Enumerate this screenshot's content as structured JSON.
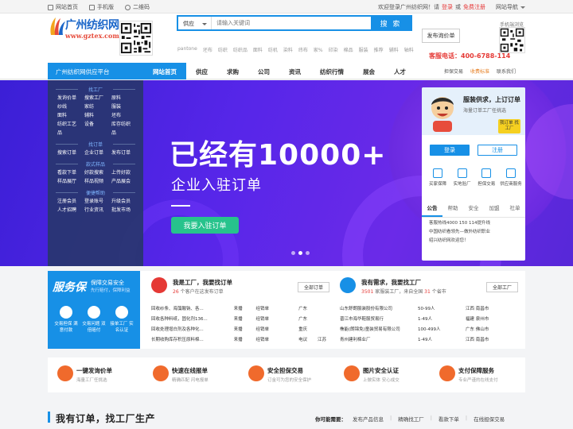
{
  "topbar": {
    "home": "网站首页",
    "mobile": "手机版",
    "qrcode": "二维码",
    "welcome": "欢迎登录广州纺织网！请",
    "login": "登录",
    "or": "或",
    "register": "免费注册",
    "sitenav": "网站导航"
  },
  "header": {
    "logo_cn": "广州纺织网",
    "logo_url": "www.gztex.com",
    "search_category": "供应",
    "search_placeholder": "请输入关键词",
    "search_button": "搜 索",
    "inquiry_button": "发布询价单",
    "hotline": "客服电话：400-6788-114",
    "mobile_label": "手机端浏览",
    "hotwords": [
      "pantone",
      "坯布",
      "纺织",
      "纺织品",
      "面料",
      "纺机",
      "染料",
      "纬布",
      "家%",
      "印染",
      "棉品",
      "服装",
      "推荐",
      "辅料",
      "轴料"
    ]
  },
  "nav": {
    "category_head": "广州纺织网供应平台",
    "items": [
      "网站首页",
      "供应",
      "求购",
      "公司",
      "资讯",
      "纺织行情",
      "展会",
      "人才"
    ],
    "right": [
      "担保交易",
      "收费标准",
      "联系我们"
    ]
  },
  "sidecat": {
    "sec1": "找工厂",
    "grid1": [
      "发询价单",
      "搜索工厂",
      "原料",
      "纱线",
      "家纺",
      "服装",
      "面料",
      "辅料",
      "坯布",
      "纺织工艺",
      "设备",
      "库存纺织",
      "品",
      "",
      "品"
    ],
    "sec2": "找订单",
    "grid2": [
      "搜索订单",
      "企业订单",
      "发布订单"
    ],
    "sec3": "款式样品",
    "grid3": [
      "看款下单",
      "好款搜索",
      "上传好款",
      "样品展厅",
      "样品视频",
      "产品展会"
    ],
    "sec4": "便捷帮助",
    "grid4": [
      "注册会员",
      "登录账号",
      "升级会员",
      "人才招聘",
      "行业资讯",
      "批发市场"
    ]
  },
  "banner": {
    "headline": "已经有10000+",
    "subline": "企业入驻订单",
    "cta": "我要入驻订单"
  },
  "panel": {
    "title": "服装供求，上订订单",
    "subtitle": "海量订单工厂任挑选",
    "tag": "我订单 找工厂",
    "login": "登录",
    "register": "注册",
    "services": [
      "买家保障",
      "实地验厂",
      "担保交易",
      "供应商服务"
    ],
    "tabs": [
      "公告",
      "帮助",
      "安全",
      "加盟",
      "社单"
    ],
    "news": [
      "客服热线4000 150 114提升线",
      "中国纺织看领先—做外纺织职业",
      "绍兴纺织网欢迎您！"
    ]
  },
  "guard": {
    "big": "服务保",
    "s1": "保障交易安全",
    "s2": "先行赔付，保障利益",
    "items": [
      "交易担保 满意付款",
      "交易问题 双倍赔付",
      "接单工厂 实名认证"
    ]
  },
  "factory": {
    "title": "我是工厂，我要找订单",
    "count_pre": "",
    "count": "26",
    "count_post": "个客户在这发布订单",
    "all": "全部订单",
    "rows": [
      [
        "回收纱条、海藻酸钠、各...",
        "来播",
        "经销单",
        "广东"
      ],
      [
        "回收各种料纸，固化剂136...",
        "来播",
        "经销单",
        "广东"
      ],
      [
        "回收处理增白剂及各种化...",
        "来播",
        "经销单",
        "重庆"
      ],
      [
        "长期收购库存积压原料棉...",
        "来播",
        "经销单",
        "电议",
        "江苏"
      ]
    ]
  },
  "buyer": {
    "title": "我有需求，我要找工厂",
    "count": "3501",
    "count_mid": "家服装工厂，来自全国",
    "provinces": "31",
    "count_post": "个省市",
    "all": "全部工厂",
    "rows": [
      [
        "山东舒朗服装股份有限公司",
        "50-99人",
        "江西 南昌市"
      ],
      [
        "晋江市海华鞋服贸易行",
        "1-49人",
        "福建 泉州市"
      ],
      [
        "樵能(朗锦免)童装贸易有限公司",
        "100-499人",
        "广东 佛山市"
      ],
      [
        "青州建利棉业厂",
        "1-49人",
        "江西 南昌市"
      ]
    ]
  },
  "features": [
    {
      "t": "一键发询价单",
      "s": "海量工厂任挑选"
    },
    {
      "t": "快速在线报单",
      "s": "精确匹配 闪电报单"
    },
    {
      "t": "安全担保交易",
      "s": "订金可为您的安全保护"
    },
    {
      "t": "图片安全认证",
      "s": "上做实体 安心成交"
    },
    {
      "t": "支付保障服务",
      "s": "专业严谨的在线支付"
    }
  ],
  "section": {
    "title": "我有订单，找工厂生产",
    "need": "你可能需要：",
    "links": [
      "发布产品信息",
      "精确找工厂",
      "看款下单",
      "在线担保交易"
    ]
  }
}
